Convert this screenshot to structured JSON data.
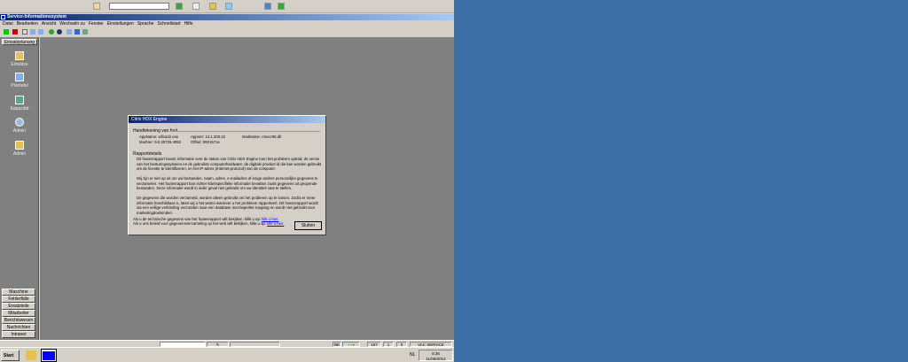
{
  "topbar": {
    "search_value": ""
  },
  "window": {
    "title": "Service-Informationssystem"
  },
  "menu": [
    "Datei",
    "Bearbeiten",
    "Ansicht",
    "Wechseln zu",
    "Fenster",
    "Einstellungen",
    "Sprache",
    "Schnellstart",
    "Hilfe"
  ],
  "sidebar": {
    "header": "Einsatzplanung",
    "items": [
      "Einsätze",
      "Plantafel",
      "Kapazität",
      "Admin",
      "Admin"
    ],
    "buttons": [
      "Maschine",
      "Fehlerfälle",
      "Ersatzteile",
      "Mitarbeiter",
      "Berichtswesen",
      "Nachrichten",
      "Intranet"
    ]
  },
  "dialog": {
    "title": "Citrix HDX Engine",
    "sig_header": "Handtekening van fout",
    "app_name": "AppName: wfica32.exe",
    "app_ver": "AppVer: 13.1.200.22",
    "mod_name": "ModName: msvcr90.dll",
    "mod_ver": "ModVer: 9.0.30729.4053",
    "offset": "Offset: 0001571e",
    "details_header": "Rapportdetails",
    "p1": "Dit foutenrapport bevat: informatie over de status van Citrix HDX Engine toen het probleem optrad; de versie van het besturingssysteem en de gebruikte computerhardware; de digitale product-id die kan worden gebruikt om de licentie te identificeren, en het IP-adres (Internet-protocol) van de computer.",
    "p2": "Wij zijn er niet op uit om uw bestanden, naam, adres, e-mailadres of enige andere persoonlijke gegevens te verzamelen. Het foutenrapport kan echter klantspecifieke informatie bevatten zoals gegevens uit geopende bestanden. Deze informatie wordt in ieder geval niet gebruikt om uw identiteit vast te stellen.",
    "p3": "De gegevens die worden verzameld, worden alleen gebruikt om het probleem op te lossen. Zodra er meer informatie beschikbaar is, laten wij u het weten wanneer u het probleem rapporteert. Dit foutenrapport wordt via een veilige verbinding verzonden naar een database met beperkte toegang en wordt niet gebruikt voor marketingdoeleinden.",
    "l1": "Als u de technische gegevens van het foutenrapport wilt bekijken, klikt u op:",
    "l1_link": "klik u hier.",
    "l2": "Als u ons beleid voor gegevensverzameling op het web wilt bekijken, klikt u op:",
    "l2_link": "klik u hier.",
    "close": "Sluiten"
  },
  "status": {
    "lang": "BE",
    "n1": "157",
    "n2": "1",
    "n3": "0",
    "user": "VAC SERVICE"
  },
  "taskbar": {
    "start": "Start",
    "lang": "NL",
    "time": "8:36",
    "date": "11/06/2012"
  }
}
